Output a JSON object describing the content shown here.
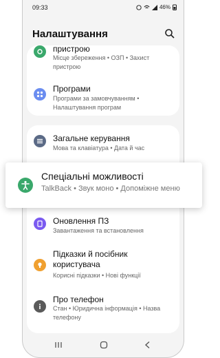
{
  "status": {
    "time": "09:33",
    "battery": "46%"
  },
  "header": {
    "title": "Налаштування"
  },
  "items": {
    "device_care": {
      "label": "пристрою",
      "sub": "Місце збереження • ОЗП • Захист пристрою"
    },
    "apps": {
      "label": "Програми",
      "sub": "Програми за замовчуванням • Налаштування програм"
    },
    "general": {
      "label": "Загальне керування",
      "sub": "Мова та клавіатура • Дата й час"
    },
    "accessibility": {
      "label": "Спеціальні можливості",
      "sub": "TalkBack  •  Звук моно  •  Допоміжне меню"
    },
    "update": {
      "label": "Оновлення ПЗ",
      "sub": "Завантаження та встановлення"
    },
    "tips": {
      "label": "Підказки й посібник користувача",
      "sub": "Корисні підказки • Нові функції"
    },
    "about": {
      "label": "Про телефон",
      "sub": "Стан • Юридична інформація • Назва телефону"
    }
  },
  "colors": {
    "green": "#3aa86b",
    "blue": "#6b8df0",
    "slate": "#5b6a86",
    "purple": "#7a5af0",
    "orange": "#f0a030"
  }
}
